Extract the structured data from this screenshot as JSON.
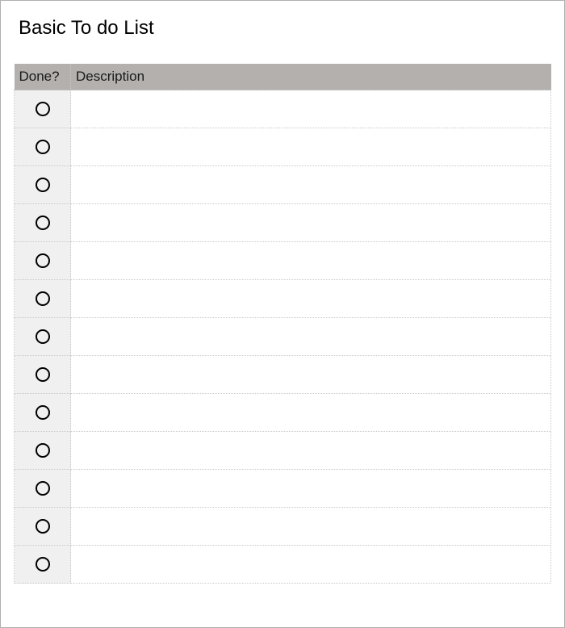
{
  "title": "Basic To do List",
  "columns": {
    "done": "Done?",
    "description": "Description"
  },
  "rows": [
    {
      "done": false,
      "description": ""
    },
    {
      "done": false,
      "description": ""
    },
    {
      "done": false,
      "description": ""
    },
    {
      "done": false,
      "description": ""
    },
    {
      "done": false,
      "description": ""
    },
    {
      "done": false,
      "description": ""
    },
    {
      "done": false,
      "description": ""
    },
    {
      "done": false,
      "description": ""
    },
    {
      "done": false,
      "description": ""
    },
    {
      "done": false,
      "description": ""
    },
    {
      "done": false,
      "description": ""
    },
    {
      "done": false,
      "description": ""
    },
    {
      "done": false,
      "description": ""
    }
  ]
}
